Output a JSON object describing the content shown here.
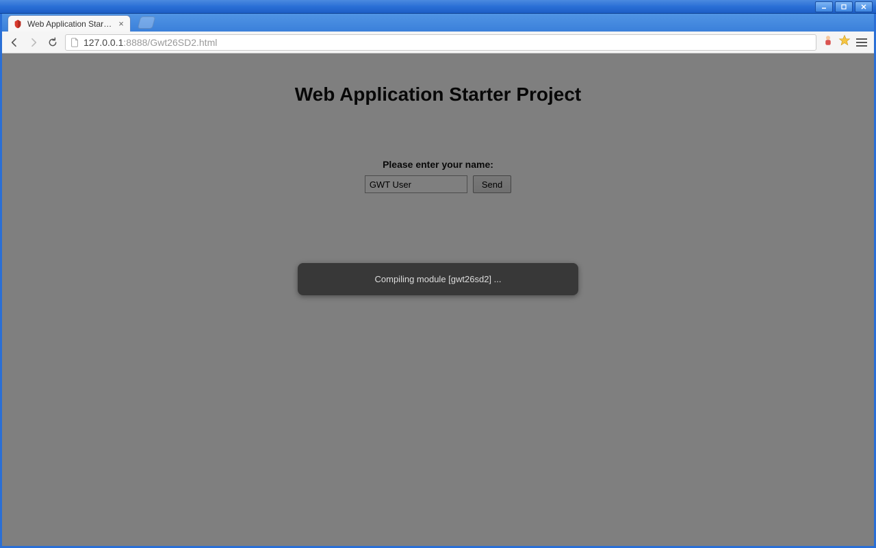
{
  "window": {
    "tab_title": "Web Application Starter Proj",
    "url_host": "127.0.0.1",
    "url_port_path": ":8888/Gwt26SD2.html"
  },
  "page": {
    "title": "Web Application Starter Project",
    "form_label": "Please enter your name:",
    "name_value": "GWT User",
    "send_label": "Send"
  },
  "status": {
    "message": "Compiling module [gwt26sd2] ..."
  }
}
